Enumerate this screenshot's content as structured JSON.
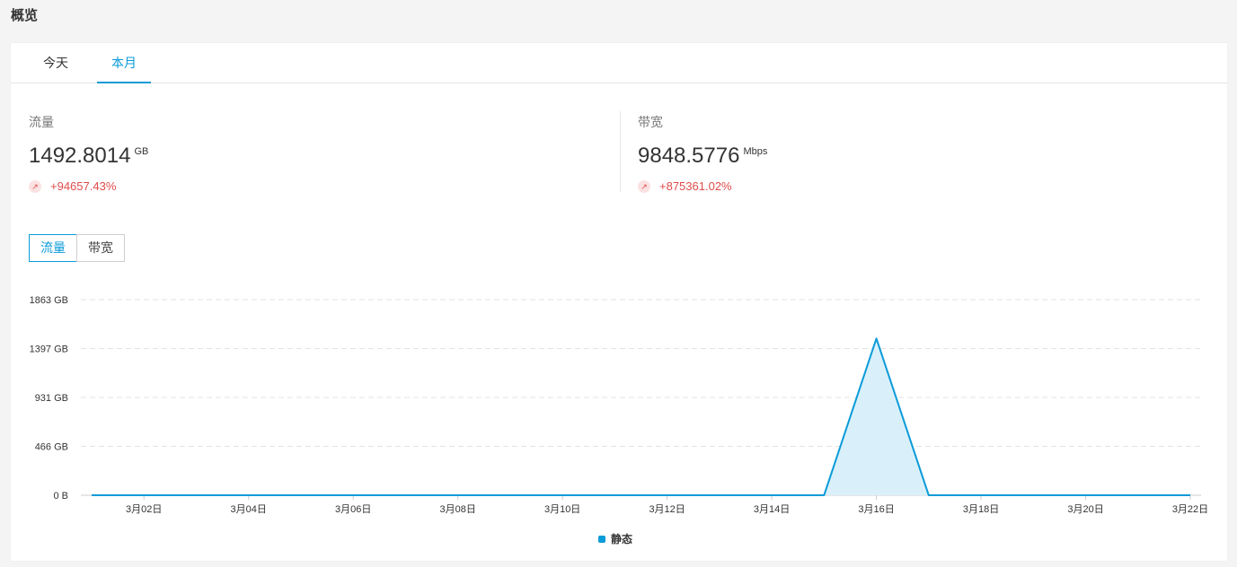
{
  "page": {
    "title": "概览"
  },
  "tabs": [
    {
      "label": "今天",
      "active": false
    },
    {
      "label": "本月",
      "active": true
    }
  ],
  "metrics": {
    "traffic": {
      "label": "流量",
      "value": "1492.8014",
      "unit": "GB",
      "change": "+94657.43%"
    },
    "bandwidth": {
      "label": "带宽",
      "value": "9848.5776",
      "unit": "Mbps",
      "change": "+875361.02%"
    }
  },
  "chart_switch": {
    "options": [
      "流量",
      "带宽"
    ],
    "selected": "流量"
  },
  "colors": {
    "accent": "#0b9bd8",
    "up": "#e04b4b",
    "area_fill": "#d9f0fa"
  },
  "chart_data": {
    "type": "area",
    "y_tick_labels": [
      "0 B",
      "466 GB",
      "931 GB",
      "1397 GB",
      "1863 GB"
    ],
    "y_tick_values": [
      0,
      466,
      931,
      1397,
      1863
    ],
    "ylim": [
      0,
      1863
    ],
    "x_tick_labels": [
      "3月02日",
      "3月04日",
      "3月06日",
      "3月08日",
      "3月10日",
      "3月12日",
      "3月14日",
      "3月16日",
      "3月18日",
      "3月20日",
      "3月22日"
    ],
    "x_tick_days": [
      2,
      4,
      6,
      8,
      10,
      12,
      14,
      16,
      18,
      20,
      22
    ],
    "grid": true,
    "legend_position": "bottom-center",
    "series": [
      {
        "name": "静态",
        "x": [
          1,
          2,
          3,
          4,
          5,
          6,
          7,
          8,
          9,
          10,
          11,
          12,
          13,
          14,
          15,
          16,
          17,
          18,
          19,
          20,
          21,
          22
        ],
        "values": [
          0,
          0,
          0,
          0,
          0,
          0,
          0,
          0,
          0,
          0,
          0,
          0,
          0,
          0,
          0,
          1492.8,
          0,
          0,
          0,
          0,
          0,
          0
        ]
      }
    ]
  }
}
